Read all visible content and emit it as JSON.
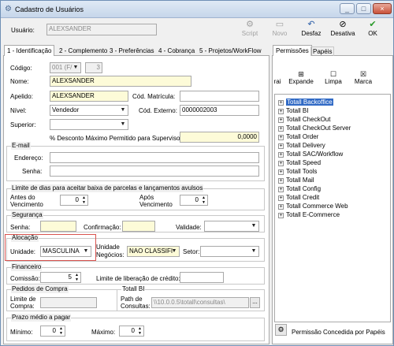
{
  "window": {
    "title": "Cadastro de Usuários",
    "min": "_",
    "max": "□",
    "close": "×"
  },
  "header": {
    "user_label": "Usuário:",
    "user_value": "ALEXSANDER"
  },
  "toolbar": [
    {
      "name": "script",
      "label": "Script",
      "icon": "⚙",
      "enabled": false
    },
    {
      "name": "novo",
      "label": "Novo",
      "icon": "▭",
      "enabled": false
    },
    {
      "name": "desfaz",
      "label": "Desfaz",
      "icon": "↶",
      "enabled": true
    },
    {
      "name": "desativa",
      "label": "Desativa",
      "icon": "⊘",
      "enabled": true
    },
    {
      "name": "ok",
      "label": "OK",
      "icon": "✔",
      "enabled": true
    }
  ],
  "tabs": [
    {
      "label": "1 - Identificação",
      "active": true
    },
    {
      "label": "2 - Complemento",
      "active": false
    },
    {
      "label": "3 - Preferências",
      "active": false
    },
    {
      "label": "4 - Cobrança",
      "active": false
    },
    {
      "label": "5 - Projetos/WorkFlow",
      "active": false
    }
  ],
  "right_tabs": [
    {
      "label": "Permissões",
      "active": true
    },
    {
      "label": "Papéis",
      "active": false
    }
  ],
  "form": {
    "codigo_label": "Código:",
    "codigo_value": "001 (F/",
    "codigo_num": "3",
    "nome_label": "Nome:",
    "nome_value": "ALEXSANDER",
    "apelido_label": "Apelido:",
    "apelido_value": "ALEXSANDER",
    "matricula_label": "Cód. Matrícula:",
    "matricula_value": "",
    "nivel_label": "Nível:",
    "nivel_value": "Vendedor",
    "externo_label": "Cód. Externo:",
    "externo_value": "0000002003",
    "superior_label": "Superior:",
    "superior_value": "",
    "desconto_label": "% Desconto Máximo Permitido para Supervisor",
    "desconto_value": "0,0000"
  },
  "email": {
    "caption": "E-mail",
    "endereco_label": "Endereço:",
    "endereco_value": "",
    "senha_label": "Senha:",
    "senha_value": ""
  },
  "limite": {
    "caption": "Limite de dias para aceitar baixa de parcelas e lançamentos avulsos",
    "antes_label_1": "Antes do",
    "antes_label_2": "Vencimento",
    "antes_value": "0",
    "apos_label_1": "Após",
    "apos_label_2": "Vencimento",
    "apos_value": "0"
  },
  "seguranca": {
    "caption": "Segurança",
    "senha_label": "Senha:",
    "confirmacao_label": "Confirmação:",
    "validade_label": "Validade:"
  },
  "alocacao": {
    "caption": "Alocação",
    "unidade_label": "Unidade:",
    "unidade_value": "MASCULINA",
    "negocios_label_1": "Unidade",
    "negocios_label_2": "Negócios:",
    "negocios_value": "NAO CLASSIFI",
    "setor_label": "Setor:",
    "setor_value": ""
  },
  "financeiro": {
    "caption": "Financeiro",
    "comissao_label": "Comissão:",
    "comissao_value": "5",
    "limite_label": "Limite de liberação de crédito:",
    "limite_value": ""
  },
  "pedidos": {
    "caption": "Pedidos de Compra",
    "limite_label_1": "Limite de",
    "limite_label_2": "Compra:"
  },
  "totalbi": {
    "caption": "Totall BI",
    "path_label_1": "Path de",
    "path_label_2": "Consultas:",
    "path_value": "\\\\10.0.0.5\\totall\\consultas\\",
    "browse": "..."
  },
  "prazo": {
    "caption": "Prazo médio a pagar",
    "minimo_label": "Mínimo:",
    "minimo_value": "0",
    "maximo_label": "Máximo:",
    "maximo_value": "0"
  },
  "permissions_toolbar": [
    {
      "label": "rai",
      "icon": ""
    },
    {
      "label": "Expande",
      "icon": "⊞"
    },
    {
      "label": "Limpa",
      "icon": "☐"
    },
    {
      "label": "Marca",
      "icon": "☒"
    }
  ],
  "tree": [
    "Totall Backoffice",
    "Totall BI",
    "Totall CheckOut",
    "Totall CheckOut Server",
    "Totall Order",
    "Totall Delivery",
    "Totall SAC/Workflow",
    "Totall Speed",
    "Totall Tools",
    "Totall Mail",
    "Totall Config",
    "Totall Credit",
    "Totall Commerce Web",
    "Totall E-Commerce"
  ],
  "footer": {
    "label": "Permissão Concedida por Papéis"
  },
  "colors": {
    "highlight_border": "#d9534f",
    "yellow_field": "#fdfbd8",
    "selection": "#316ac5"
  }
}
